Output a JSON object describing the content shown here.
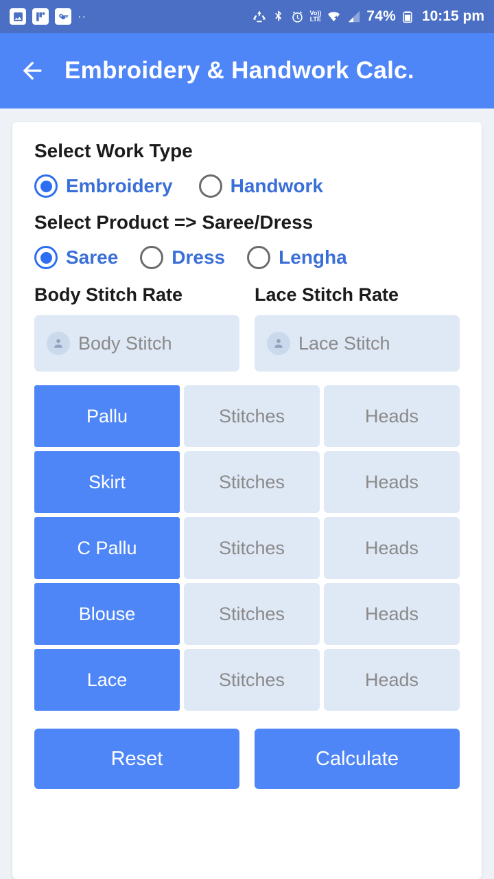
{
  "statusbar": {
    "left_icons": [
      "image-icon",
      "flipboard-icon",
      "key-icon",
      "more-dots-icon"
    ],
    "more_dots": "··",
    "right_icons": [
      "recycle-icon",
      "bluetooth-icon",
      "alarm-icon",
      "volte-icon",
      "wifi-icon",
      "mobile-data-icon",
      "signal-icon"
    ],
    "volte_label": "Vo))",
    "lte_label": "LTE",
    "battery_percent": "74%",
    "time": "10:15 pm"
  },
  "appbar": {
    "back_icon": "back-arrow-icon",
    "title": "Embroidery & Handwork Calc."
  },
  "work_type": {
    "label": "Select Work Type",
    "options": [
      {
        "label": "Embroidery",
        "selected": true
      },
      {
        "label": "Handwork",
        "selected": false
      }
    ]
  },
  "product": {
    "label": "Select Product => Saree/Dress",
    "options": [
      {
        "label": "Saree",
        "selected": true
      },
      {
        "label": "Dress",
        "selected": false
      },
      {
        "label": "Lengha",
        "selected": false
      }
    ]
  },
  "rates": {
    "body": {
      "title": "Body Stitch Rate",
      "placeholder": "Body Stitch",
      "value": ""
    },
    "lace": {
      "title": "Lace Stitch Rate",
      "placeholder": "Lace Stitch",
      "value": ""
    }
  },
  "grid": {
    "stitches_placeholder": "Stitches",
    "heads_placeholder": "Heads",
    "rows": [
      {
        "label": "Pallu",
        "stitches": "Stitches",
        "heads": "Heads"
      },
      {
        "label": "Skirt",
        "stitches": "Stitches",
        "heads": "Heads"
      },
      {
        "label": "C Pallu",
        "stitches": "Stitches",
        "heads": "Heads"
      },
      {
        "label": "Blouse",
        "stitches": "Stitches",
        "heads": "Heads"
      },
      {
        "label": "Lace",
        "stitches": "Stitches",
        "heads": "Heads"
      }
    ]
  },
  "actions": {
    "reset": "Reset",
    "calculate": "Calculate"
  },
  "colors": {
    "status_bar": "#4a6fc4",
    "app_bar": "#4f86f7",
    "accent": "#4f86f7",
    "input_bg": "#dfe8f5",
    "link_text": "#3a6fd8"
  }
}
